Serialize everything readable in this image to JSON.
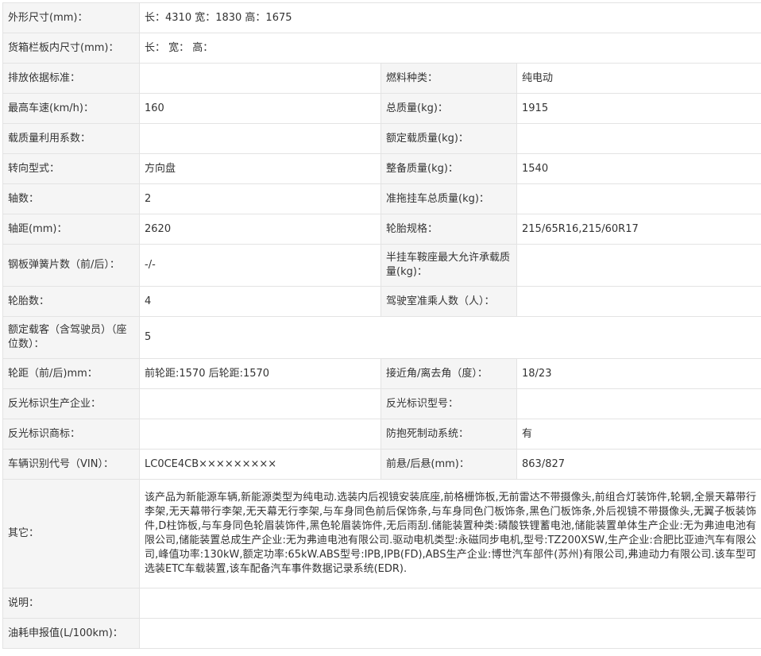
{
  "rows": {
    "dimensions": {
      "label": "外形尺寸(mm)：",
      "value": "长：4310 宽：1830 高：1675"
    },
    "cargo_box": {
      "label": "货箱栏板内尺寸(mm)：",
      "value": "长： 宽： 高："
    },
    "emission": {
      "label": "排放依据标准：",
      "value": "",
      "label2": "燃料种类：",
      "value2": "纯电动"
    },
    "speed": {
      "label": "最高车速(km/h)：",
      "value": "160",
      "label2": "总质量(kg)：",
      "value2": "1915"
    },
    "load_factor": {
      "label": "载质量利用系数：",
      "value": "",
      "label2": "额定载质量(kg)：",
      "value2": ""
    },
    "steering": {
      "label": "转向型式：",
      "value": "方向盘",
      "label2": "整备质量(kg)：",
      "value2": "1540"
    },
    "axles": {
      "label": "轴数：",
      "value": "2",
      "label2": "准拖挂车总质量(kg)：",
      "value2": ""
    },
    "wheelbase": {
      "label": "轴距(mm)：",
      "value": "2620",
      "label2": "轮胎规格：",
      "value2": "215/65R16,215/60R17"
    },
    "springs": {
      "label": "钢板弹簧片数（前/后）：",
      "value": "-/-",
      "label2": "半挂车鞍座最大允许承载质量(kg)：",
      "value2": ""
    },
    "tires": {
      "label": "轮胎数：",
      "value": "4",
      "label2": "驾驶室准乘人数（人）：",
      "value2": ""
    },
    "passengers": {
      "label": "额定载客（含驾驶员）（座位数）：",
      "value": "5"
    },
    "track": {
      "label": "轮距（前/后)mm：",
      "value": "前轮距:1570 后轮距:1570",
      "label2": "接近角/离去角（度）：",
      "value2": "18/23"
    },
    "reflector_maker": {
      "label": "反光标识生产企业：",
      "value": "",
      "label2": "反光标识型号：",
      "value2": ""
    },
    "reflector_brand": {
      "label": "反光标识商标：",
      "value": "",
      "label2": "防抱死制动系统：",
      "value2": "有"
    },
    "vin": {
      "label": "车辆识别代号（VIN）：",
      "value": "LC0CE4CB×××××××××",
      "label2": "前悬/后悬(mm)：",
      "value2": "863/827"
    },
    "other": {
      "label": "其它：",
      "value": "该产品为新能源车辆,新能源类型为纯电动.选装内后视镜安装底座,前格栅饰板,无前雷达不带摄像头,前组合灯装饰件,轮辋,全景天幕带行李架,无天幕带行李架,无天幕无行李架,与车身同色前后保饰条,与车身同色门板饰条,黑色门板饰条,外后视镜不带摄像头,无翼子板装饰件,D柱饰板,与车身同色轮眉装饰件,黑色轮眉装饰件,无后雨刮.储能装置种类:磷酸铁锂蓄电池,储能装置单体生产企业:无为弗迪电池有限公司,储能装置总成生产企业:无为弗迪电池有限公司.驱动电机类型:永磁同步电机,型号:TZ200XSW,生产企业:合肥比亚迪汽车有限公司,峰值功率:130kW,额定功率:65kW.ABS型号:IPB,IPB(FD),ABS生产企业:博世汽车部件(苏州)有限公司,弗迪动力有限公司.该车型可选装ETC车载装置,该车配备汽车事件数据记录系统(EDR)."
    },
    "remark": {
      "label": "说明：",
      "value": ""
    },
    "fuel": {
      "label": "油耗申报值(L/100km)：",
      "value": ""
    }
  }
}
